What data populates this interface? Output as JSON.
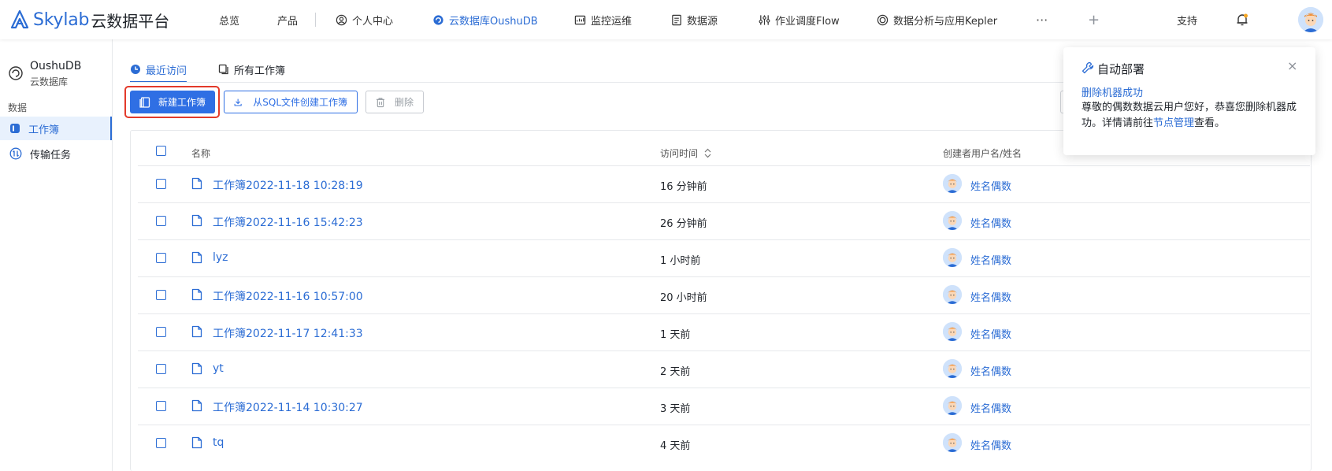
{
  "app": {
    "logo_en": "Skylab",
    "logo_cn": "云数据平台"
  },
  "nav": {
    "items": [
      {
        "label": "总览"
      },
      {
        "label": "产品"
      },
      {
        "label": "个人中心"
      },
      {
        "label": "云数据库OushuDB"
      },
      {
        "label": "监控运维"
      },
      {
        "label": "数据源"
      },
      {
        "label": "作业调度Flow"
      },
      {
        "label": "数据分析与应用Kepler"
      }
    ],
    "more": "···",
    "add": "+",
    "support": "支持"
  },
  "sidebar": {
    "title": "OushuDB",
    "subtitle": "云数据库",
    "group": "数据",
    "items": [
      {
        "label": "工作簿",
        "active": true
      },
      {
        "label": "传输任务",
        "active": false
      }
    ]
  },
  "tabs": [
    {
      "label": "最近访问",
      "active": true
    },
    {
      "label": "所有工作簿",
      "active": false
    }
  ],
  "toolbar": {
    "new_label": "新建工作簿",
    "from_sql_label": "从SQL文件创建工作簿",
    "delete_label": "删除"
  },
  "table": {
    "headers": {
      "name": "名称",
      "time": "访问时间",
      "creator": "创建者用户名/姓名"
    },
    "rows": [
      {
        "name": "工作簿2022-11-18 10:28:19",
        "time": "16 分钟前",
        "user": "姓名偶数"
      },
      {
        "name": "工作簿2022-11-16 15:42:23",
        "time": "26 分钟前",
        "user": "姓名偶数"
      },
      {
        "name": "lyz",
        "time": "1 小时前",
        "user": "姓名偶数"
      },
      {
        "name": "工作簿2022-11-16 10:57:00",
        "time": "20 小时前",
        "user": "姓名偶数"
      },
      {
        "name": "工作簿2022-11-17 12:41:33",
        "time": "1 天前",
        "user": "姓名偶数"
      },
      {
        "name": "yt",
        "time": "2 天前",
        "user": "姓名偶数"
      },
      {
        "name": "工作簿2022-11-14 10:30:27",
        "time": "3 天前",
        "user": "姓名偶数"
      },
      {
        "name": "tq",
        "time": "4 天前",
        "user": "姓名偶数"
      }
    ]
  },
  "toast": {
    "title": "自动部署",
    "subtitle": "删除机器成功",
    "body_prefix": "尊敬的偶数数据云用户您好，恭喜您删除机器成功。详情请前往",
    "body_link": "节点管理",
    "body_suffix": "查看。",
    "close": "×"
  },
  "colors": {
    "brand": "#2b6cd4",
    "primary_button": "#2f6fe4",
    "highlight_border": "#e33a2a"
  }
}
